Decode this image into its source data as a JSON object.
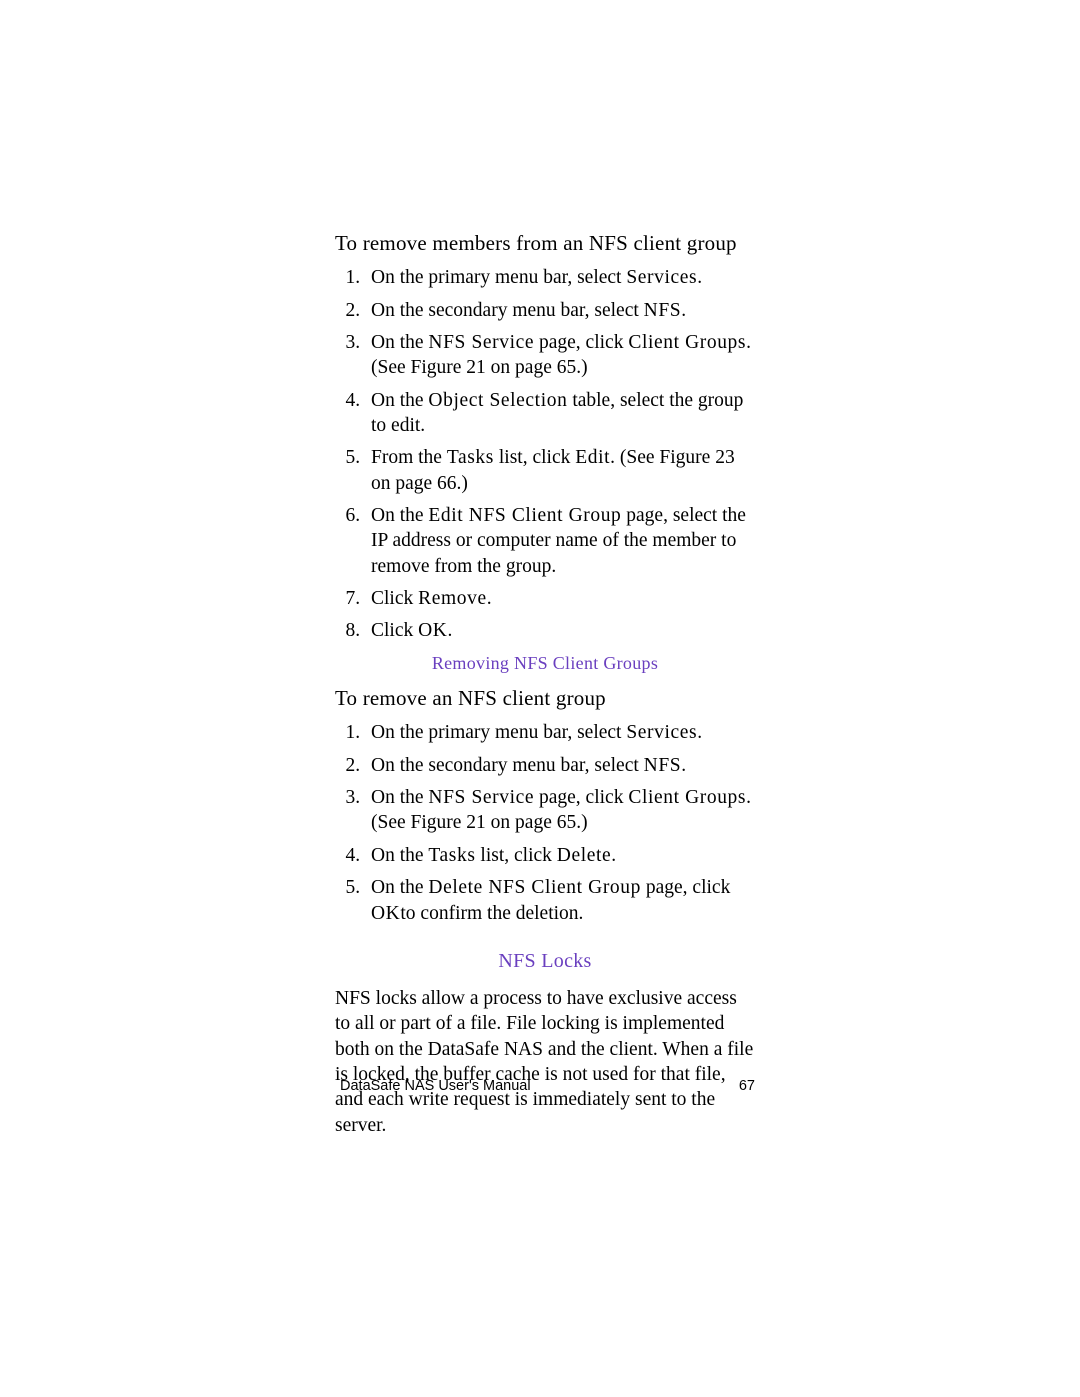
{
  "section1": {
    "heading": "To remove members from an NFS client group",
    "steps": [
      [
        {
          "t": "On the primary menu bar, select "
        },
        {
          "t": "Services",
          "ls": true
        },
        {
          "t": "."
        }
      ],
      [
        {
          "t": "On the secondary menu bar, select "
        },
        {
          "t": "NFS",
          "ls": true
        },
        {
          "t": "."
        }
      ],
      [
        {
          "t": "On the "
        },
        {
          "t": "NFS Service",
          "ls": true
        },
        {
          "t": " page, click "
        },
        {
          "t": "Client Groups",
          "ls": true
        },
        {
          "t": ". (See Figure 21 on page 65.)"
        }
      ],
      [
        {
          "t": "On the "
        },
        {
          "t": "Object Selection",
          "ls": true
        },
        {
          "t": " table, select the group to edit."
        }
      ],
      [
        {
          "t": "From the "
        },
        {
          "t": "Tasks",
          "ls": true
        },
        {
          "t": " list, click "
        },
        {
          "t": "Edit",
          "ls": true
        },
        {
          "t": ". (See Figure 23 on page 66.)"
        }
      ],
      [
        {
          "t": "On the "
        },
        {
          "t": "Edit NFS Client Group",
          "ls": true
        },
        {
          "t": " page, select the IP address or computer name of the member to remove from the group."
        }
      ],
      [
        {
          "t": "Click "
        },
        {
          "t": "Remove",
          "ls": true
        },
        {
          "t": "."
        }
      ],
      [
        {
          "t": "Click "
        },
        {
          "t": "OK",
          "ls": true
        },
        {
          "t": "."
        }
      ]
    ]
  },
  "subsection_title_1": "Removing NFS Client Groups",
  "section2": {
    "heading": "To remove an NFS client group",
    "steps": [
      [
        {
          "t": "On the primary menu bar, select "
        },
        {
          "t": "Services",
          "ls": true
        },
        {
          "t": "."
        }
      ],
      [
        {
          "t": "On the secondary menu bar, select "
        },
        {
          "t": "NFS",
          "ls": true
        },
        {
          "t": "."
        }
      ],
      [
        {
          "t": "On the "
        },
        {
          "t": "NFS Service",
          "ls": true
        },
        {
          "t": " page, click "
        },
        {
          "t": "Client Groups",
          "ls": true
        },
        {
          "t": ". (See Figure 21 on page 65.)"
        }
      ],
      [
        {
          "t": "On the "
        },
        {
          "t": "Tasks",
          "ls": true
        },
        {
          "t": " list, click "
        },
        {
          "t": "Delete",
          "ls": true
        },
        {
          "t": "."
        }
      ],
      [
        {
          "t": "On the "
        },
        {
          "t": "Delete NFS Client Group",
          "ls": true
        },
        {
          "t": " page, click "
        },
        {
          "t": "OK",
          "ls": true
        },
        {
          "t": "to confirm the deletion."
        }
      ]
    ]
  },
  "subsection_title_2": "NFS Locks",
  "locks_paragraph": "NFS locks allow a process to have exclusive access to all or part of a file. File locking is implemented both on the DataSafe NAS and the client. When a file is locked, the buffer cache is not used for that file, and each write request is immediately sent to the server.",
  "footer": {
    "title": "DataSafe NAS User's Manual",
    "page": "67"
  }
}
